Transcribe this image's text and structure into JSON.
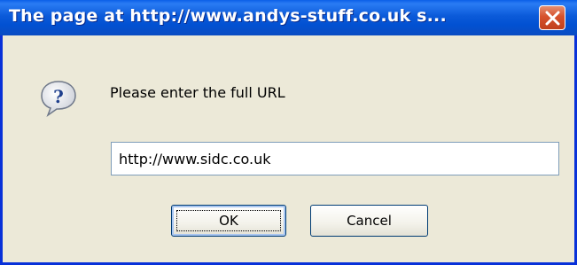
{
  "window": {
    "title": "The page at http://www.andys-stuff.co.uk s..."
  },
  "icons": {
    "close": "close-icon",
    "question": "question-icon"
  },
  "dialog": {
    "prompt": "Please enter the full URL",
    "input_value": "http://www.sidc.co.uk",
    "ok_label": "OK",
    "cancel_label": "Cancel"
  },
  "colors": {
    "titlebar": "#0251d2",
    "close_button": "#d6512c",
    "dialog_background": "#ece9d8",
    "button_border": "#003c74"
  }
}
